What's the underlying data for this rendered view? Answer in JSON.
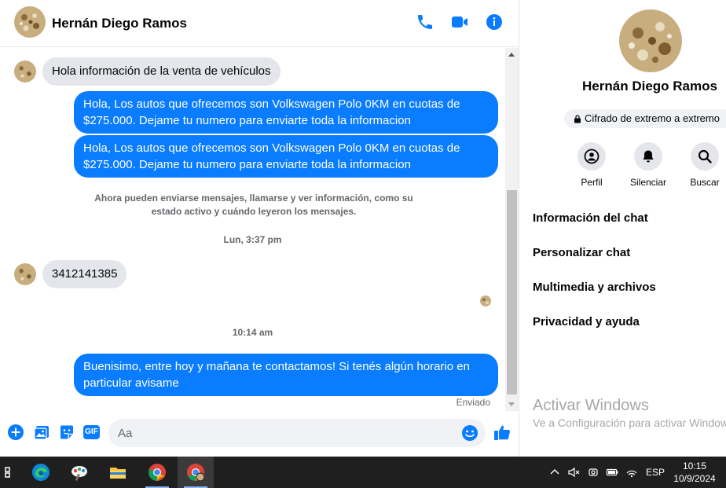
{
  "contact": {
    "name": "Hernán Diego Ramos"
  },
  "messages": {
    "in_1": "Hola información de la venta de vehículos",
    "out_1": "Hola, Los autos que ofrecemos son Volkswagen Polo 0KM en cuotas de $275.000. Dejame tu numero para enviarte toda la informacion",
    "out_2": "Hola, Los autos que ofrecemos son Volkswagen Polo 0KM en cuotas de $275.000. Dejame tu numero para enviarte toda la informacion",
    "system_note": "Ahora pueden enviarse mensajes, llamarse y ver información, como su estado activo y cuándo leyeron los mensajes.",
    "time_1": "Lun, 3:37 pm",
    "in_2": "3412141385",
    "time_2": "10:14 am",
    "out_3": "Buenisimo, entre hoy y mañana te contactamos! Si tenés algún horario en particular avisame",
    "status": "Enviado"
  },
  "composer": {
    "placeholder": "Aa",
    "gif_label": "GIF"
  },
  "info_panel": {
    "encryption": "Cifrado de extremo a extremo",
    "actions": {
      "profile": "Perfil",
      "mute": "Silenciar",
      "search": "Buscar"
    },
    "menu": {
      "chat_info": "Información del chat",
      "customize": "Personalizar chat",
      "media": "Multimedia y archivos",
      "privacy": "Privacidad y ayuda"
    },
    "watermark_title": "Activar Windows",
    "watermark_sub": "Ve a Configuración para activar Windows."
  },
  "taskbar": {
    "language": "ESP",
    "time": "10:15",
    "date": "10/9/2024"
  },
  "colors": {
    "accent": "#0a7cff",
    "bubble_in": "#e4e6eb"
  }
}
